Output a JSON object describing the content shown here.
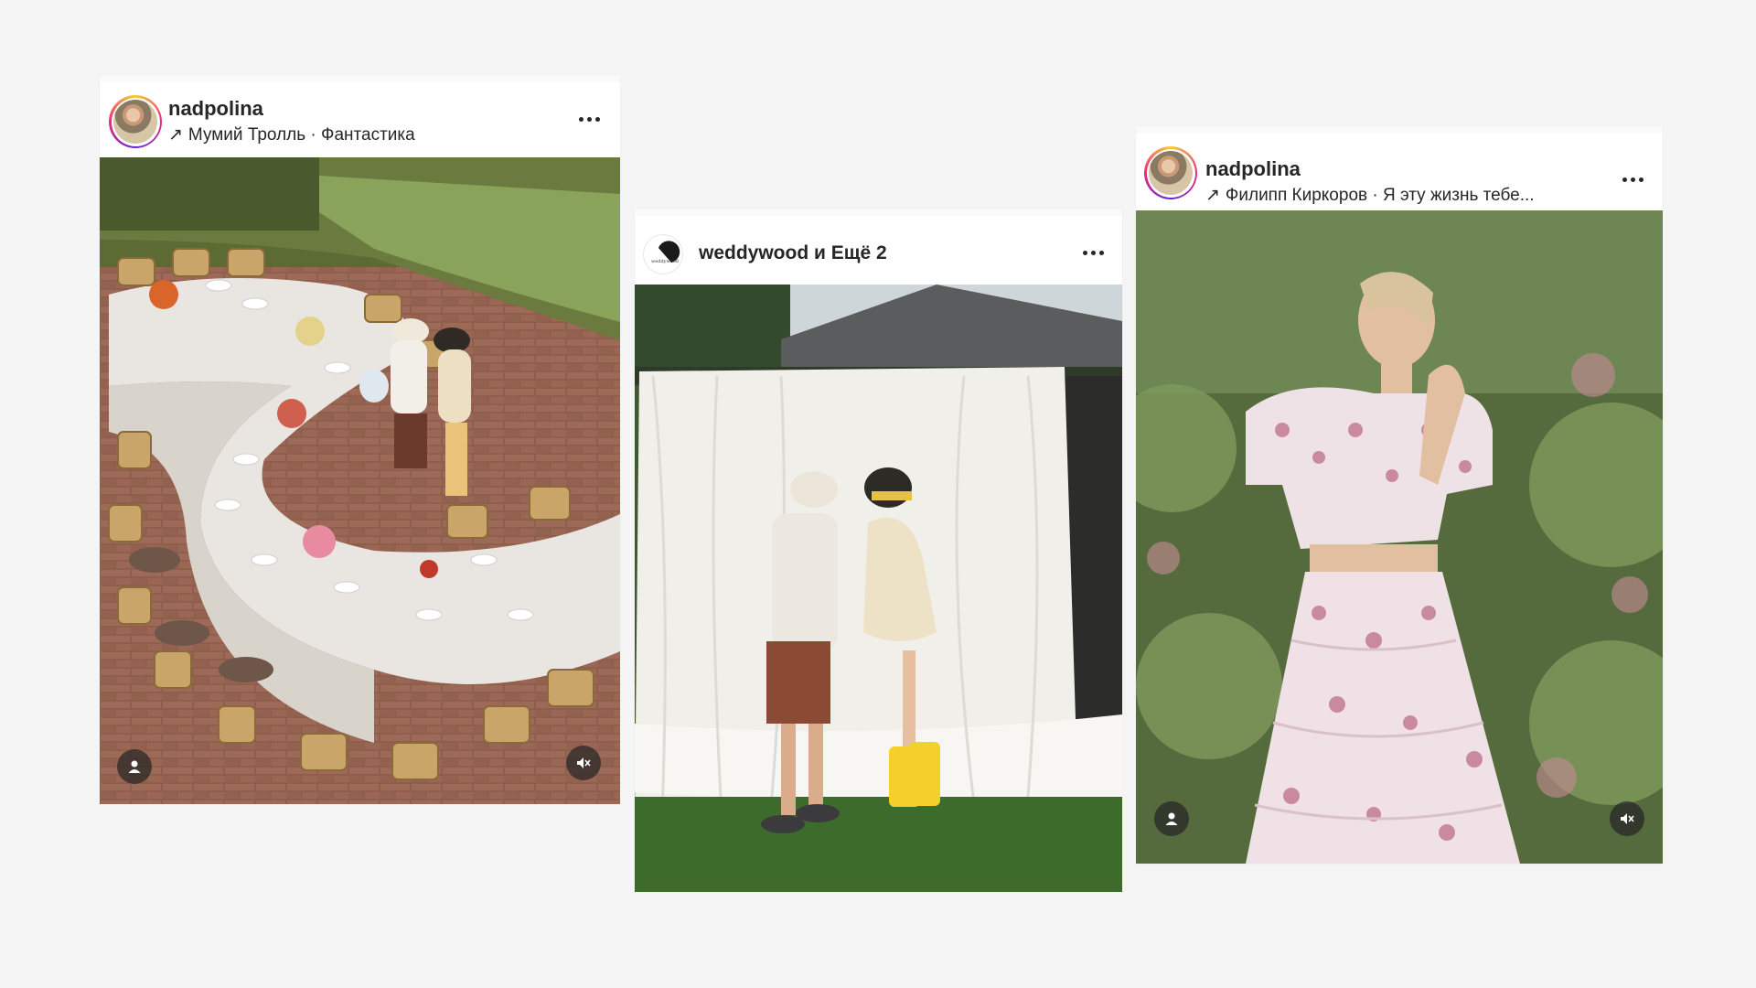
{
  "posts": [
    {
      "username": "nadpolina",
      "audio": "Мумий Тролль · Фантастика",
      "arrow": "↗",
      "more_icon": "more-horizontal-icon",
      "photo_description_icon": "photo"
    },
    {
      "username": "weddywood",
      "username_extra": " и Ещё 2",
      "avatar_text": "weddywood",
      "more_icon": "more-horizontal-icon"
    },
    {
      "username": "nadpolina",
      "audio": "Филипп Киркоров · Я эту жизнь тебе...",
      "arrow": "↗",
      "more_icon": "more-horizontal-icon"
    }
  ],
  "icons": {
    "tagged": "user-tag-icon",
    "mute": "muted-speaker-icon"
  }
}
